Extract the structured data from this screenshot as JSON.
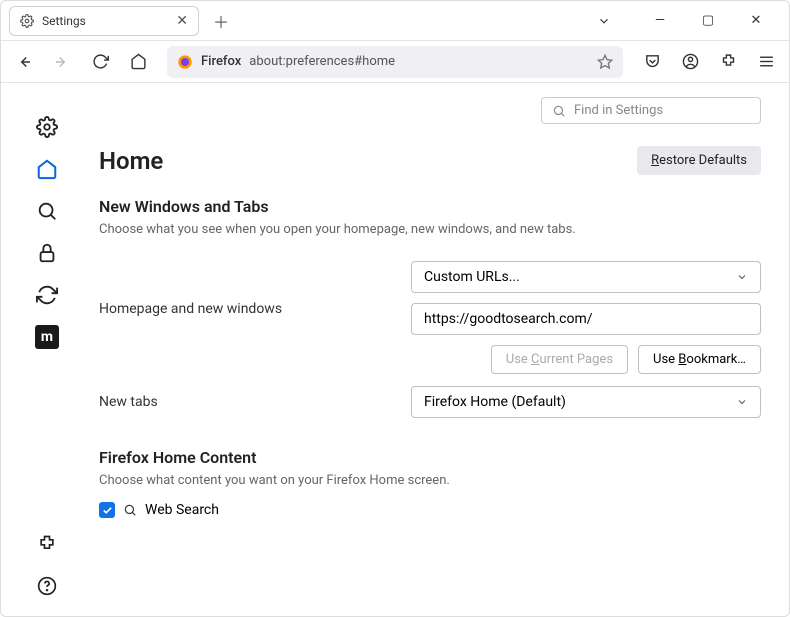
{
  "tab": {
    "title": "Settings"
  },
  "urlbar": {
    "brand": "Firefox",
    "path": "about:preferences#home"
  },
  "search": {
    "placeholder": "Find in Settings"
  },
  "page": {
    "title": "Home",
    "restore": "Restore Defaults",
    "section1_title": "New Windows and Tabs",
    "section1_desc": "Choose what you see when you open your homepage, new windows, and new tabs.",
    "homepage_label": "Homepage and new windows",
    "homepage_select": "Custom URLs...",
    "homepage_url": "https://goodtosearch.com/",
    "use_current": "Use Current Pages",
    "use_bookmark": "Use Bookmark…",
    "newtabs_label": "New tabs",
    "newtabs_select": "Firefox Home (Default)",
    "section2_title": "Firefox Home Content",
    "section2_desc": "Choose what content you want on your Firefox Home screen.",
    "websearch": "Web Search"
  }
}
